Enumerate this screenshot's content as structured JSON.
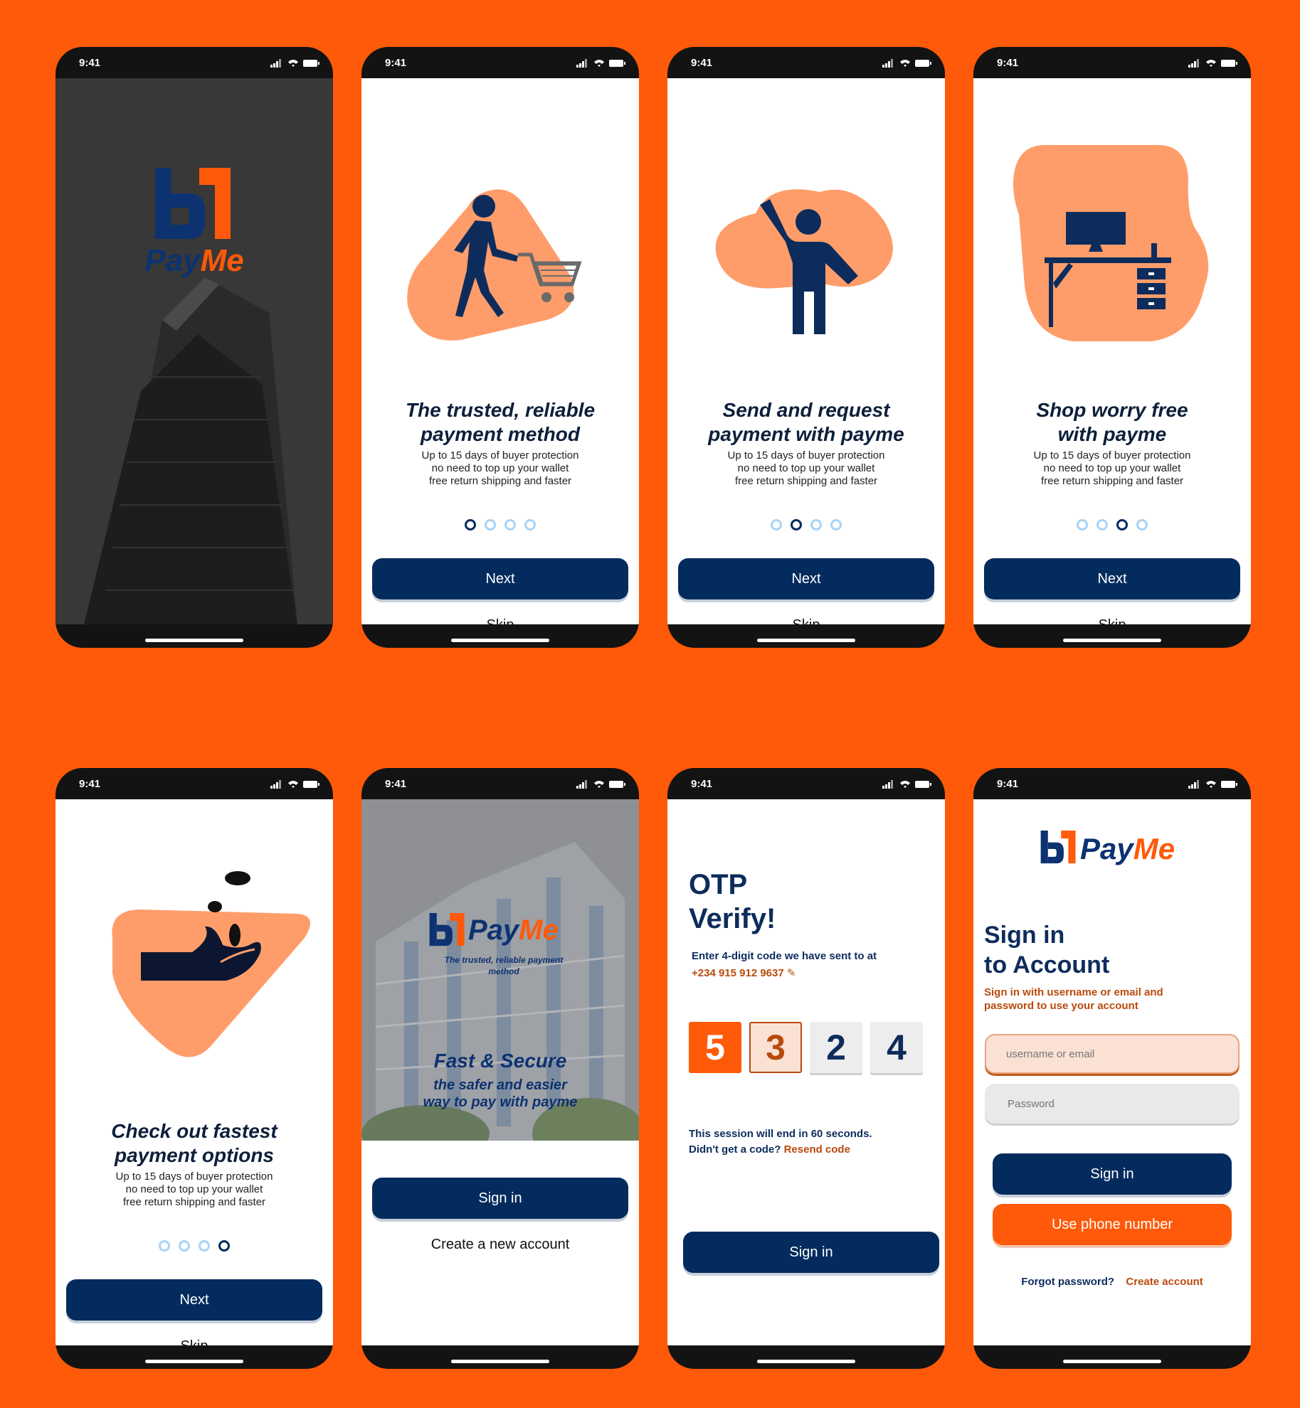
{
  "status": {
    "time": "9:41"
  },
  "brand": {
    "pay": "Pay",
    "me": "Me",
    "tagline": "The trusted, reliable payment method"
  },
  "description_lines": [
    "Up to 15 days of buyer protection",
    "no need to top up your wallet",
    "free return shipping and faster"
  ],
  "onboarding": [
    {
      "title_lines": [
        "The trusted, reliable",
        "payment method"
      ],
      "active_dot": 0
    },
    {
      "title_lines": [
        "Send and request",
        "payment with payme"
      ],
      "active_dot": 1
    },
    {
      "title_lines": [
        "Shop worry free",
        "with payme"
      ],
      "active_dot": 2
    },
    {
      "title_lines": [
        "Check out fastest",
        "payment options"
      ],
      "active_dot": 3
    }
  ],
  "buttons": {
    "next": "Next",
    "skip": "Skip",
    "sign_in": "Sign in",
    "create_new_account": "Create a new account",
    "use_phone": "Use phone number"
  },
  "welcome": {
    "headline": "Fast & Secure",
    "sub_lines": [
      "the safer and easier",
      "way to pay with payme"
    ]
  },
  "otp": {
    "title_lines": [
      "OTP",
      "Verify!"
    ],
    "instruction": "Enter 4-digit code we have sent to at",
    "phone": "+234 915 912 9637",
    "digits": [
      "5",
      "3",
      "2",
      "4"
    ],
    "session": "This session will end in 60 seconds.",
    "no_code": "Didn't get a code?",
    "resend": "Resend code"
  },
  "signin": {
    "title_lines": [
      "Sign in",
      "to Account"
    ],
    "subtitle_lines": [
      "Sign in with username or email and",
      "password to use your account"
    ],
    "username_placeholder": "username or email",
    "password_placeholder": "Password",
    "forgot": "Forgot password?",
    "create": "Create account"
  },
  "colors": {
    "background": "#FF5A09",
    "navy": "#042B5E",
    "peach": "#FF9D6A",
    "blue_dot": "#A9D3F6"
  }
}
